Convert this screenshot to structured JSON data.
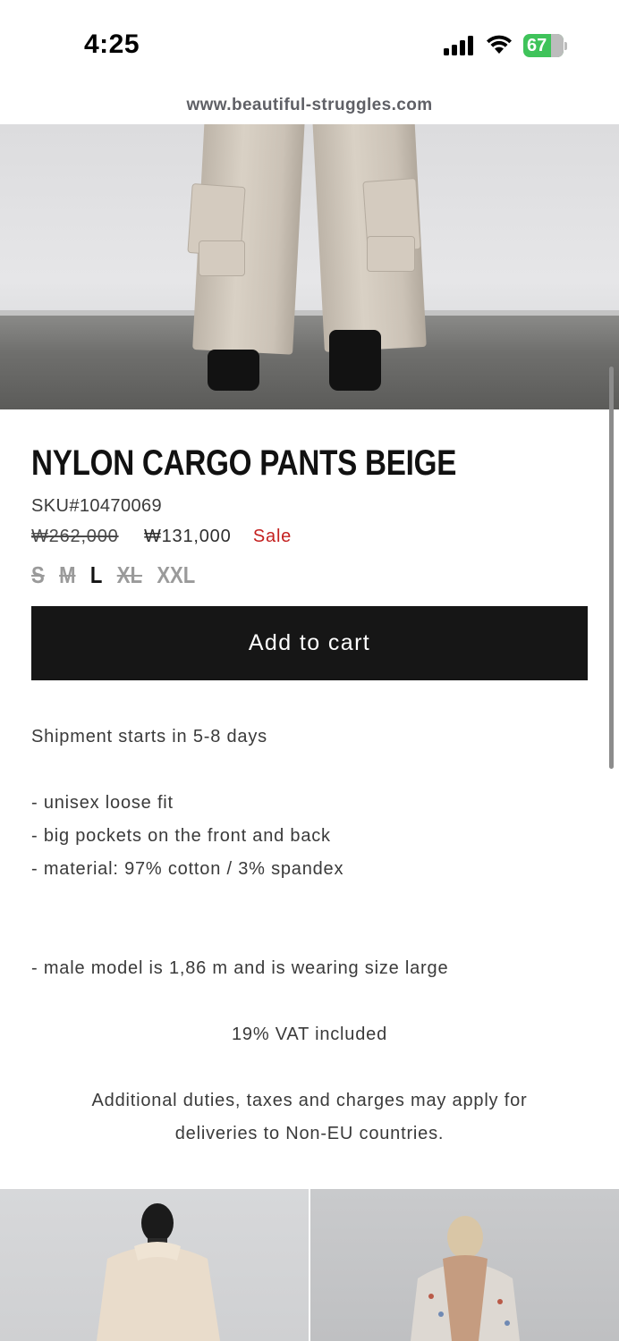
{
  "status_bar": {
    "time": "4:25",
    "battery_level": "67",
    "icons": [
      "signal-icon",
      "wifi-icon",
      "battery-charging-icon"
    ]
  },
  "browser": {
    "url": "www.beautiful-struggles.com"
  },
  "product": {
    "title": "NYLON CARGO PANTS BEIGE",
    "sku": "SKU#10470069",
    "old_price": "₩262,000",
    "new_price": "₩131,000",
    "sale_label": "Sale",
    "sizes": [
      {
        "label": "S",
        "state": "sold-out"
      },
      {
        "label": "M",
        "state": "sold-out"
      },
      {
        "label": "L",
        "state": "selected"
      },
      {
        "label": "XL",
        "state": "sold-out"
      },
      {
        "label": "XXL",
        "state": "available"
      }
    ],
    "add_to_cart_label": "Add to cart"
  },
  "description": {
    "shipment": "Shipment starts in 5-8 days",
    "bullets": [
      "- unisex loose fit",
      "- big pockets on the front and back",
      "- material: 97% cotton / 3% spandex"
    ],
    "model_note": "- male model is 1,86 m and is wearing size large",
    "vat": "19% VAT included",
    "duties_line1": "Additional duties, taxes and charges may apply for",
    "duties_line2": "deliveries to Non-EU countries."
  },
  "colors": {
    "button_bg": "#161616",
    "sale_red": "#c4201f",
    "battery_green": "#3fc35a"
  }
}
